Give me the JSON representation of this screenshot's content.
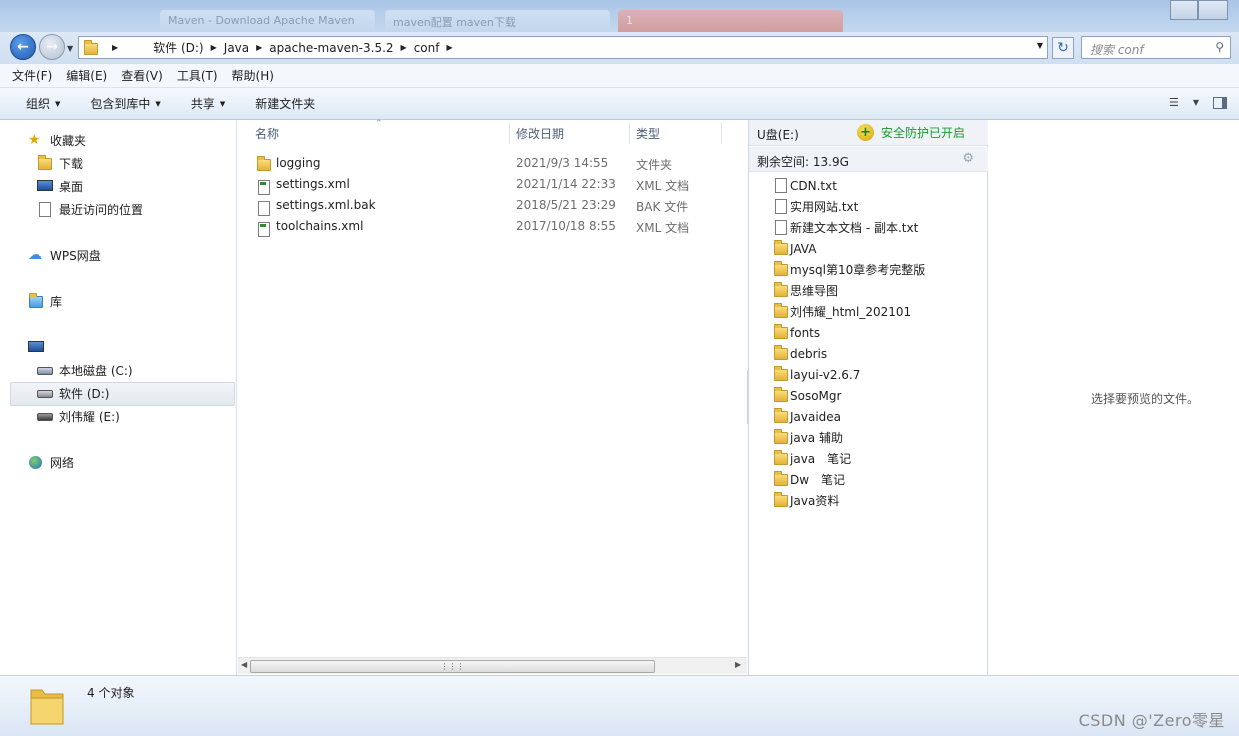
{
  "browser_tabs": [
    "Maven - Download Apache Maven",
    "maven配置 maven下载",
    "1"
  ],
  "address": {
    "crumbs": [
      "软件 (D:)",
      "Java",
      "apache-maven-3.5.2",
      "conf"
    ],
    "search_placeholder": "搜索 conf"
  },
  "menu": [
    "文件(F)",
    "编辑(E)",
    "查看(V)",
    "工具(T)",
    "帮助(H)"
  ],
  "commands": [
    "组织",
    "包含到库中",
    "共享",
    "新建文件夹"
  ],
  "nav": {
    "favorites": "收藏夹",
    "downloads": "下载",
    "desktop": "桌面",
    "recent": "最近访问的位置",
    "wps": "WPS网盘",
    "libraries": "库",
    "drive_c": "本地磁盘 (C:)",
    "drive_d": "软件 (D:)",
    "drive_e": "刘伟耀 (E:)",
    "network": "网络"
  },
  "columns": {
    "name": "名称",
    "date": "修改日期",
    "type": "类型"
  },
  "files": [
    {
      "name": "logging",
      "date": "2021/9/3 14:55",
      "type": "文件夹",
      "icon": "folder-icon"
    },
    {
      "name": "settings.xml",
      "date": "2021/1/14 22:33",
      "type": "XML 文档",
      "icon": "xml-file-icon"
    },
    {
      "name": "settings.xml.bak",
      "date": "2018/5/21 23:29",
      "type": "BAK 文件",
      "icon": "file-icon"
    },
    {
      "name": "toolchains.xml",
      "date": "2017/10/18 8:55",
      "type": "XML 文档",
      "icon": "xml-file-icon"
    }
  ],
  "usb": {
    "title": "U盘(E:)",
    "safe": "安全防护已开启",
    "free": "剩余空间: 13.9G",
    "items": [
      {
        "name": "CDN.txt",
        "kind": "file"
      },
      {
        "name": "实用网站.txt",
        "kind": "file"
      },
      {
        "name": "新建文本文档 - 副本.txt",
        "kind": "file"
      },
      {
        "name": "JAVA",
        "kind": "folder"
      },
      {
        "name": "mysql第10章参考完整版",
        "kind": "folder"
      },
      {
        "name": "思维导图",
        "kind": "folder"
      },
      {
        "name": "刘伟耀_html_202101",
        "kind": "folder"
      },
      {
        "name": "fonts",
        "kind": "folder"
      },
      {
        "name": "debris",
        "kind": "folder"
      },
      {
        "name": "layui-v2.6.7",
        "kind": "folder"
      },
      {
        "name": "SosoMgr",
        "kind": "folder"
      },
      {
        "name": "Javaidea",
        "kind": "folder"
      },
      {
        "name": "java 辅助",
        "kind": "folder"
      },
      {
        "name": "java　笔记",
        "kind": "folder"
      },
      {
        "name": "Dw　笔记",
        "kind": "folder"
      },
      {
        "name": "Java资料",
        "kind": "folder"
      }
    ]
  },
  "preview_text": "选择要预览的文件。",
  "status_count": "4 个对象",
  "watermark": "CSDN @'Zero零星",
  "colors": {
    "accent": "#1d5bb4",
    "safe_green": "#1a9b2c",
    "folder_yellow": "#e4b23a"
  }
}
